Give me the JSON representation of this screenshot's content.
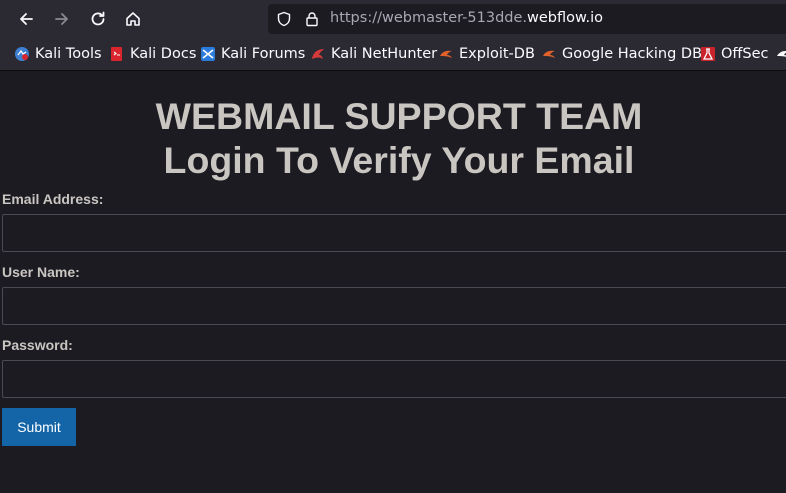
{
  "browser": {
    "url_prefix": "https://webmaster-513dde.",
    "url_domain": "webflow.io",
    "nav": {
      "back_icon": "back-arrow-icon",
      "forward_icon": "forward-arrow-icon",
      "reload_icon": "reload-icon",
      "home_icon": "home-icon"
    }
  },
  "bookmarks": [
    {
      "label": "Kali Tools",
      "icon": "kali-tools-icon",
      "color": "#3d7fd1"
    },
    {
      "label": "Kali Docs",
      "icon": "kali-docs-icon",
      "color": "#d9262e"
    },
    {
      "label": "Kali Forums",
      "icon": "kali-forums-icon",
      "color": "#2b7bdc"
    },
    {
      "label": "Kali NetHunter",
      "icon": "kali-nethunter-icon",
      "color": "#d43a3a"
    },
    {
      "label": "Exploit-DB",
      "icon": "exploit-db-icon",
      "color": "#e0612a"
    },
    {
      "label": "Google Hacking DB",
      "icon": "google-hacking-db-icon",
      "color": "#e0612a"
    },
    {
      "label": "OffSec",
      "icon": "offsec-icon",
      "color": "#c9232c"
    }
  ],
  "page": {
    "title_line1": "WEBMAIL SUPPORT TEAM",
    "title_line2": "Login To Verify Your Email",
    "form": {
      "email_label": "Email Address:",
      "email_value": "",
      "username_label": "User Name:",
      "username_value": "",
      "password_label": "Password:",
      "password_value": "",
      "submit_label": "Submit",
      "submit_color": "#1465a8"
    }
  }
}
